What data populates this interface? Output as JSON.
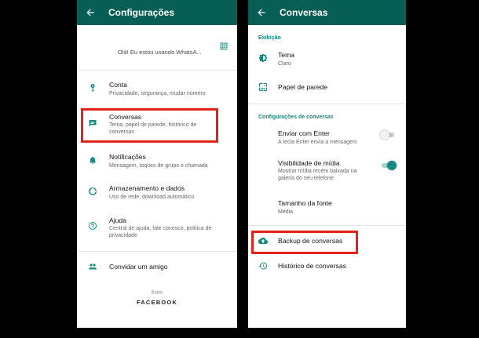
{
  "left": {
    "title": "Configurações",
    "profile_status": "Olá! Eu estou usando WhatsA...",
    "items": [
      {
        "label": "Conta",
        "sub": "Privacidade, segurança, mudar número"
      },
      {
        "label": "Conversas",
        "sub": "Tema, papel de parede, histórico de conversas"
      },
      {
        "label": "Notificações",
        "sub": "Mensagem, toques de grupo e chamada"
      },
      {
        "label": "Armazenamento e dados",
        "sub": "Uso de rede, download automático"
      },
      {
        "label": "Ajuda",
        "sub": "Central de ajuda, fale conosco, política de privacidade"
      },
      {
        "label": "Convidar um amigo"
      }
    ],
    "from": "from",
    "brand": "FACEBOOK"
  },
  "right": {
    "title": "Conversas",
    "section_display": "Exibição",
    "tema_label": "Tema",
    "tema_value": "Claro",
    "wallpaper_label": "Papel de parede",
    "section_chat_settings": "Configurações de conversas",
    "enter_label": "Enviar com Enter",
    "enter_sub": "A tecla Enter envia a mensagem",
    "enter_on": false,
    "media_label": "Visibilidade de mídia",
    "media_sub": "Mostrar mídia recém baixada na galeria do seu telefone",
    "media_on": true,
    "font_label": "Tamanho da fonte",
    "font_value": "Média",
    "backup_label": "Backup de conversas",
    "history_label": "Histórico de conversas"
  },
  "colors": {
    "header": "#075E54",
    "accent": "#128C7E",
    "highlight": "#E2231A",
    "background": "#000000"
  },
  "icons": [
    "back-arrow-icon",
    "qr-code-icon",
    "key-icon",
    "chat-icon",
    "bell-icon",
    "storage-icon",
    "help-icon",
    "people-icon",
    "theme-icon",
    "wallpaper-icon",
    "cloud-upload-icon",
    "history-icon"
  ]
}
